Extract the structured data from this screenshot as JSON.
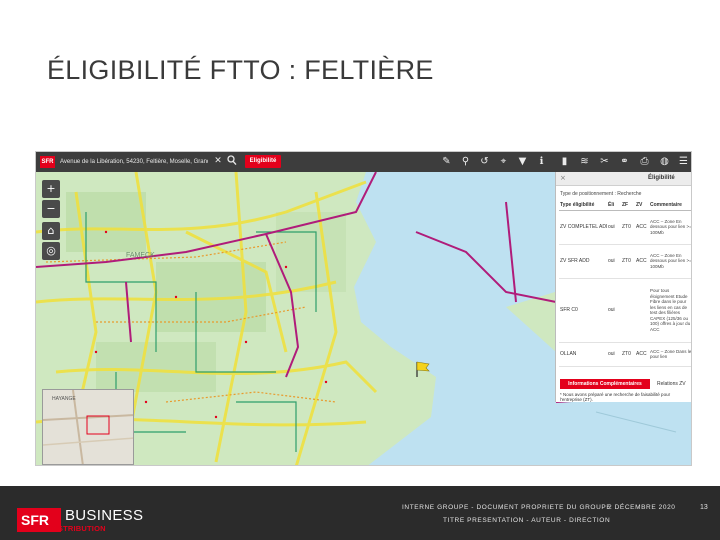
{
  "slide": {
    "title": "ÉLIGIBILITÉ FTTO : FELTIÈRE"
  },
  "app": {
    "logo_text": "SFR",
    "address_value": "Avenue de la Libération, 54230, Feltière, Moselle, Grand Est, FR",
    "eligibility_button": "Eligibilité",
    "clear_icon": "close-icon",
    "search_icon": "search-icon",
    "toolbar_icons": [
      "pencil-icon",
      "measure-icon",
      "history-icon",
      "pin-icon",
      "filter-icon",
      "info-icon",
      "bookmark-icon",
      "layers-icon",
      "tools-icon",
      "link-icon",
      "print-icon",
      "menu-icon"
    ]
  },
  "map": {
    "zoom_in": "+",
    "zoom_out": "−",
    "home_icon": "home-icon",
    "locate_icon": "target-icon",
    "overview_label": "HAYANGE",
    "flag_icon": "flag-icon",
    "colors": {
      "base": "#cfe8c0",
      "zone": "#bde0f3",
      "fiber": "#b01c7a",
      "roads": "#f1e03a",
      "network_green": "#2f9e6b"
    }
  },
  "panel": {
    "close": "×",
    "title": "Éligibilité",
    "type_line": "Type de positionnement : Recherche",
    "headers": [
      "Type éligibilité",
      "Éli",
      "ZF",
      "ZV",
      "Commentaire"
    ],
    "rows": [
      {
        "type": "ZV COMPLETEL ADD",
        "eli": "oui",
        "zf": "ZT0",
        "zv": "ACC",
        "comment": "ACC – Zone En dessous pour lien >= 100Mb"
      },
      {
        "type": "ZV SFR ADD",
        "eli": "oui",
        "zf": "ZT0",
        "zv": "ACC",
        "comment": "ACC – Zone En dessous pour lien >= 100Mb"
      },
      {
        "type": "SFR C0",
        "eli": "oui",
        "zf": "",
        "zv": "",
        "comment": "Pour tous éloignement Etude Fibre dans le pour les liens en cas de test des filières CAPEX (125/36 ou 100) offres à jour du ACC"
      },
      {
        "type": "OLLAN",
        "eli": "oui",
        "zf": "ZT0",
        "zv": "ACC",
        "comment": "ACC – Zone Dans le pour lien"
      }
    ],
    "info_button": "Informations Complémentaires",
    "link_label": "Relations ZV",
    "note": "* Nous avons préparé une recherche de faisabilité pour l'entreprise (ZT)."
  },
  "footer": {
    "sfr": "SFR",
    "business": "BUSINESS",
    "distribution": "DISTRIBUTION",
    "doc_line": "INTERNE GROUPE - DOCUMENT PROPRIETE DU GROUPE",
    "date": "2 DÉCEMBRE 2020",
    "sub_line": "TITRE PRESENTATION - AUTEUR - DIRECTION",
    "page": "13"
  }
}
